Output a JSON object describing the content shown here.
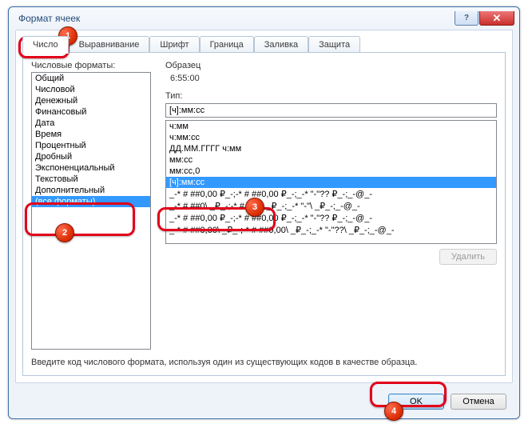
{
  "window": {
    "title": "Формат ячеек"
  },
  "tabs": {
    "items": [
      {
        "label": "Число"
      },
      {
        "label": "Выравнивание"
      },
      {
        "label": "Шрифт"
      },
      {
        "label": "Граница"
      },
      {
        "label": "Заливка"
      },
      {
        "label": "Защита"
      }
    ],
    "active_index": 0
  },
  "categories": {
    "label": "Числовые форматы:",
    "items": [
      "Общий",
      "Числовой",
      "Денежный",
      "Финансовый",
      "Дата",
      "Время",
      "Процентный",
      "Дробный",
      "Экспоненциальный",
      "Текстовый",
      "Дополнительный",
      "(все форматы)"
    ],
    "selected_index": 11
  },
  "sample": {
    "label": "Образец",
    "value": "6:55:00"
  },
  "type_field": {
    "label": "Тип:",
    "value": "[ч]:мм:сс"
  },
  "type_list": {
    "items": [
      "ч:мм",
      "ч:мм:сс",
      "ДД.ММ.ГГГГ ч:мм",
      "мм:сс",
      "мм:сс,0",
      "[ч]:мм:сс",
      "_-* # ##0,00 ₽_-;-* # ##0,00 ₽_-;_-* \"-\"?? ₽_-;_-@_-",
      "_-* # ##0\\ _₽_-;-* # ##0\\ _₽_-;_-* \"-\"\\ _₽_-;_-@_-",
      "_-* # ##0,00 ₽_-;-* # ##0,00 ₽_-;_-* \"-\"?? ₽_-;_-@_-",
      "_-* # ##0,00\\ _₽_-;-* # ##0,00\\ _₽_-;_-* \"-\"??\\ _₽_-;_-@_-"
    ],
    "selected_index": 5
  },
  "buttons": {
    "delete": "Удалить",
    "ok": "OK",
    "cancel": "Отмена"
  },
  "hint": "Введите код числового формата, используя один из существующих кодов в качестве образца.",
  "annotations": {
    "m1": "1",
    "m2": "2",
    "m3": "3",
    "m4": "4"
  }
}
